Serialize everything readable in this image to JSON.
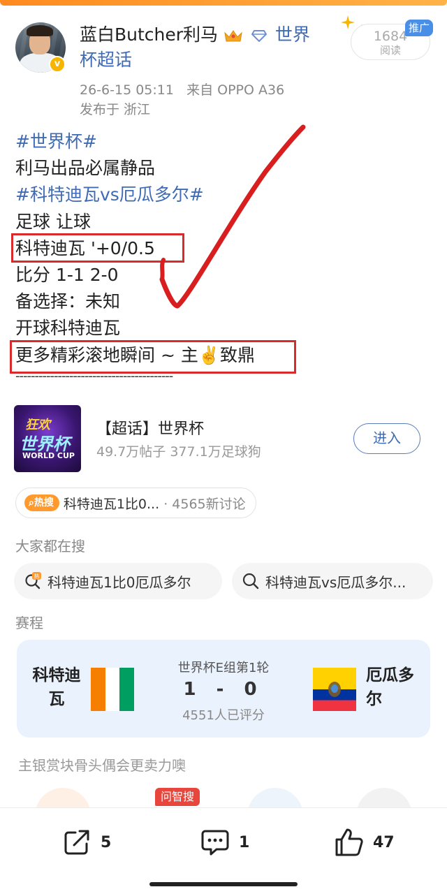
{
  "post": {
    "username": "蓝白Butcher利马",
    "topic_line1": "世界",
    "topic_line2": "杯超话",
    "timestamp": "26-6-15 05:11",
    "source": "来自 OPPO A36",
    "location": "发布于 浙江",
    "read_count": "1684",
    "read_label": "阅读",
    "promo_label": "推广",
    "lines": [
      "#世界杯#",
      "利马出品必属静品",
      "#科特迪瓦vs厄瓜多尔#",
      "足球 让球",
      "科特迪瓦 '+0/0.5",
      "比分  1-1 2-0",
      "备选择：未知",
      "开球科特迪瓦",
      "更多精彩滚地瞬间 ~ 主✌️致鼎"
    ],
    "divider": "-----------------------------------------"
  },
  "topic_card": {
    "thumb_line1": "狂欢",
    "thumb_line2": "世界杯",
    "thumb_line3": "WORLD CUP",
    "title": "【超话】世界杯",
    "subtitle": "49.7万帖子 377.1万足球狗",
    "button": "进入"
  },
  "hot_search": {
    "tag": "热搜",
    "text": "科特迪瓦1比0...",
    "count": "· 4565新讨论"
  },
  "people_search": {
    "title": "大家都在搜",
    "chips": [
      "科特迪瓦1比0厄瓜多尔",
      "科特迪瓦vs厄瓜多尔..."
    ]
  },
  "schedule": {
    "title": "赛程",
    "home_team": "科特迪瓦",
    "away_team": "厄瓜多尔",
    "round": "世界杯E组第1轮",
    "score": "1 - 0",
    "rated": "4551人已评分"
  },
  "reward": {
    "text": "主银赏块骨头偶会更卖力噢",
    "tag": "问智搜"
  },
  "actions": {
    "share_count": "5",
    "comment_count": "1",
    "like_count": "47"
  },
  "colors": {
    "link_blue": "#3f6bb5",
    "highlight_red": "#d92b2b",
    "hot_orange": "#ff9a2e",
    "card_bg": "#eaf2fd"
  }
}
